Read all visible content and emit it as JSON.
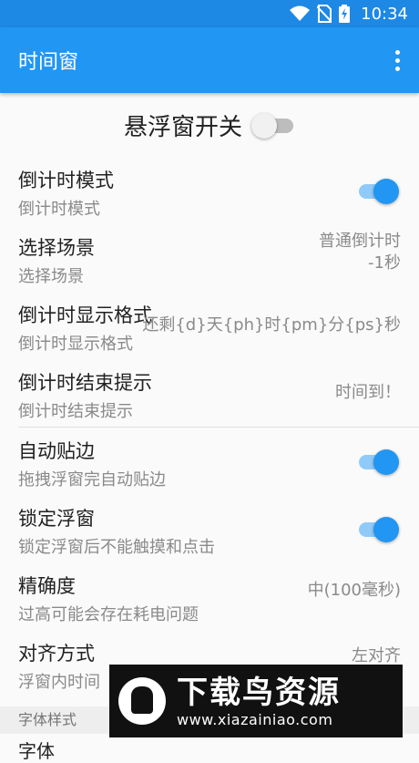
{
  "status_bar": {
    "time": "10:34"
  },
  "app_bar": {
    "title": "时间窗",
    "menu_icon": "more-vert-icon"
  },
  "master": {
    "label": "悬浮窗开关",
    "enabled": false
  },
  "settings": [
    {
      "title": "倒计时模式",
      "summary": "倒计时模式",
      "switch": true
    },
    {
      "title": "选择场景",
      "summary": "选择场景",
      "value_lines": [
        "普通倒计时",
        "-1秒"
      ]
    },
    {
      "title": "倒计时显示格式",
      "summary": "倒计时显示格式",
      "value": "还剩{d}天{ph}时{pm}分{ps}秒"
    },
    {
      "title": "倒计时结束提示",
      "summary": "倒计时结束提示",
      "value": "时间到！"
    },
    {
      "title": "自动贴边",
      "summary": "拖拽浮窗完自动贴边",
      "switch": true
    },
    {
      "title": "锁定浮窗",
      "summary": "锁定浮窗后不能触摸和点击",
      "switch": true
    },
    {
      "title": "精确度",
      "summary": "过高可能会存在耗电问题",
      "value": "中(100毫秒)"
    },
    {
      "title": "对齐方式",
      "summary": "浮窗内时间",
      "value": "左对齐"
    }
  ],
  "category": {
    "label": "字体样式"
  },
  "partial_item": {
    "title": "字体"
  },
  "watermark": {
    "title": "下载鸟资源",
    "url": "www.xiazainiao.com"
  },
  "colors": {
    "primary": "#2196f3",
    "status_bar": "#1e88e5",
    "switch_track_on": "#90caf9"
  }
}
